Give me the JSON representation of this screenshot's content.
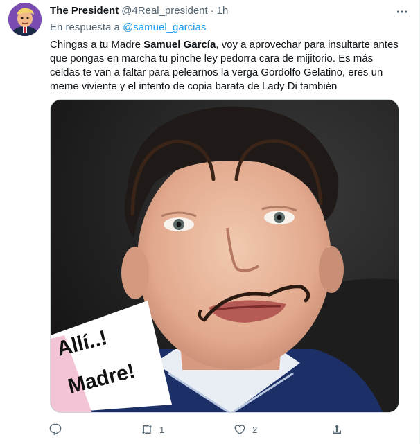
{
  "tweet": {
    "display_name": "The President",
    "handle": "@4Real_president",
    "separator": "·",
    "time": "1h",
    "reply_prefix": "En respuesta a ",
    "reply_to": "@samuel_garcias",
    "text_before": "Chingas a tu Madre ",
    "text_bold": "Samuel García",
    "text_after": ", voy a aprovechar para insultarte antes que pongas en marcha tu pinche ley pedorra cara de mijitorio. Es más celdas te van a faltar para pelearnos la verga Gordolfo Gelatino, eres un meme viviente y el intento de copia barata de Lady Di también",
    "image_caption_line1": "Allí..!",
    "image_caption_line2": "Madre!"
  },
  "actions": {
    "reply_count": "",
    "retweet_count": "1",
    "like_count": "2",
    "share_count": ""
  },
  "icons": [
    "more-icon",
    "reply-icon",
    "retweet-icon",
    "like-icon",
    "share-icon"
  ],
  "colors": {
    "text": "#0f1419",
    "secondary": "#536471",
    "link": "#1d9bf0",
    "border": "#cfd9de"
  }
}
